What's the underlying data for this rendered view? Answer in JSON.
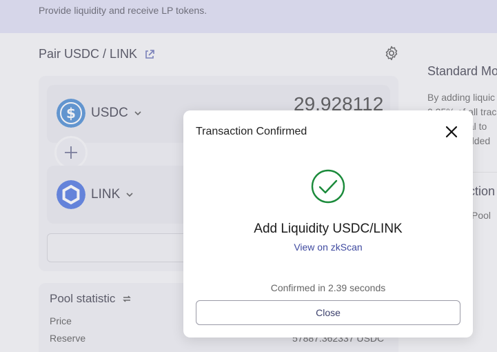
{
  "banner": {
    "subtitle": "Provide liquidity and receive LP tokens."
  },
  "pair": {
    "title": "Pair USDC / LINK"
  },
  "tokens": [
    {
      "symbol": "USDC",
      "amount": "29.928112",
      "color": "#2775ca",
      "icon": "usdc-icon"
    },
    {
      "symbol": "LINK",
      "amount": "",
      "color": "#2a5ada",
      "icon": "chainlink-icon"
    }
  ],
  "stats": {
    "title": "Pool statistic",
    "price_label": "Price",
    "reserve_label": "Reserve",
    "reserve_value": "57887.362337 USDC"
  },
  "side": {
    "heading": "Standard Mo",
    "lines": [
      "By adding liquic",
      "0.25% of all trac",
      "nal to",
      "dded"
    ],
    "heading2": "ction",
    "line2": "Pool"
  },
  "modal": {
    "title": "Transaction Confirmed",
    "heading": "Add Liquidity USDC/LINK",
    "link_text": "View on zkScan",
    "confirmed_text": "Confirmed in 2.39 seconds",
    "close_label": "Close",
    "success_color": "#1a8a3a"
  }
}
